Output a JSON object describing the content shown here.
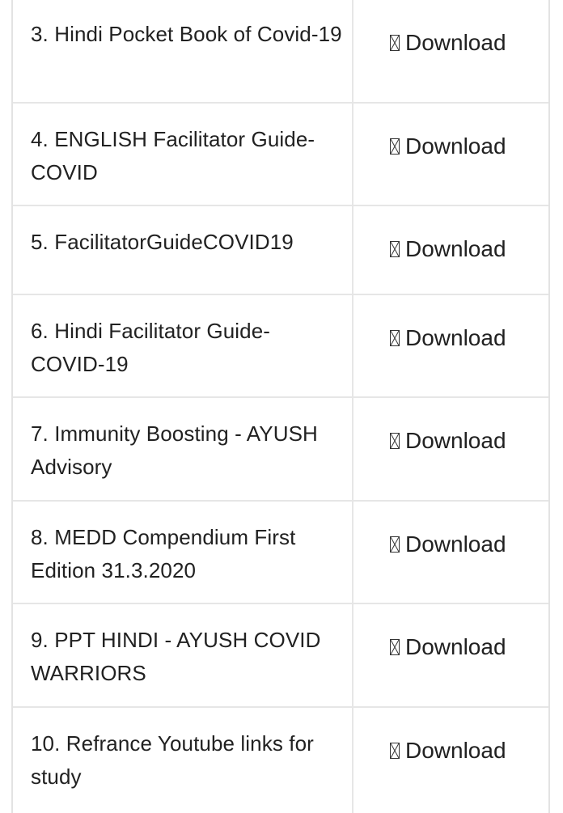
{
  "download_label": "Download",
  "download_glyph": "missing-glyph-icon",
  "rows": [
    {
      "title": "3. Hindi Pocket Book of Covid-19",
      "link": "Download"
    },
    {
      "title": "4. ENGLISH Facilitator Guide-COVID",
      "link": "Download"
    },
    {
      "title": "5. FacilitatorGuideCOVID19",
      "link": "Download"
    },
    {
      "title": "6. Hindi Facilitator Guide-COVID-19",
      "link": "Download"
    },
    {
      "title": "7. Immunity Boosting - AYUSH Advisory",
      "link": "Download"
    },
    {
      "title": "8. MEDD Compendium First Edition 31.3.2020",
      "link": "Download"
    },
    {
      "title": "9. PPT HINDI - AYUSH COVID WARRIORS",
      "link": "Download"
    },
    {
      "title": "10. Refrance Youtube links for study",
      "link": "Download"
    }
  ]
}
